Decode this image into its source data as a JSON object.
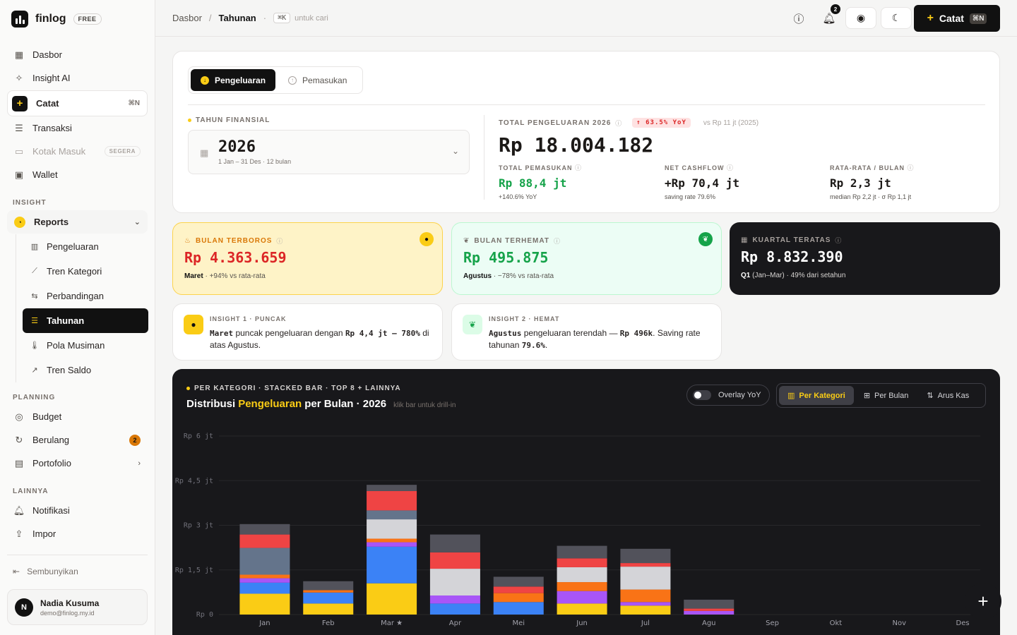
{
  "brand": {
    "name": "finlog",
    "plan": "FREE"
  },
  "sidebar": {
    "main": [
      {
        "label": "Dasbor",
        "icon": "grid-icon"
      },
      {
        "label": "Insight AI",
        "icon": "sparkle-icon"
      }
    ],
    "catat": {
      "label": "Catat",
      "shortcut": "⌘N"
    },
    "records": [
      {
        "label": "Transaksi"
      },
      {
        "label": "Kotak Masuk",
        "tag": "SEGERA"
      },
      {
        "label": "Wallet"
      }
    ],
    "insight_label": "INSIGHT",
    "reports": {
      "label": "Reports"
    },
    "report_items": [
      {
        "label": "Pengeluaran"
      },
      {
        "label": "Tren Kategori"
      },
      {
        "label": "Perbandingan"
      },
      {
        "label": "Tahunan"
      },
      {
        "label": "Pola Musiman"
      },
      {
        "label": "Tren Saldo"
      }
    ],
    "planning_label": "PLANNING",
    "planning": [
      {
        "label": "Budget"
      },
      {
        "label": "Berulang",
        "count": "2"
      },
      {
        "label": "Portofolio"
      }
    ],
    "other_label": "LAINNYA",
    "other": [
      {
        "label": "Notifikasi"
      },
      {
        "label": "Impor"
      }
    ],
    "hide_label": "Sembunyikan",
    "user": {
      "initial": "N",
      "name": "Nadia Kusuma",
      "email": "demo@finlog.my.id"
    }
  },
  "topbar": {
    "crumb_root": "Dasbor",
    "crumb_current": "Tahunan",
    "search_key": "⌘K",
    "search_hint": "untuk cari",
    "notif_count": "2",
    "catat_label": "Catat",
    "catat_shortcut": "⌘N"
  },
  "summary": {
    "tabs": [
      "Pengeluaran",
      "Pemasukan"
    ],
    "fiscal_label": "TAHUN FINANSIAL",
    "year": "2026",
    "year_range": "1 Jan – 31 Des · 12 bulan",
    "total_label": "TOTAL PENGELUARAN 2026",
    "yoy": "↑ 63.5% YoY",
    "vs_prev": "vs Rp 11 jt (2025)",
    "total_value": "Rp 18.004.182",
    "kpis": [
      {
        "label": "TOTAL PEMASUKAN",
        "value": "Rp 88,4 jt",
        "sub": "+140.6% YoY"
      },
      {
        "label": "NET CASHFLOW",
        "value": "+Rp 70,4 jt",
        "sub": "saving rate 79.6%"
      },
      {
        "label": "RATA-RATA / BULAN",
        "value": "Rp 2,3 jt",
        "sub": "median Rp 2,2 jt · σ Rp 1,1 jt"
      }
    ]
  },
  "highlights": {
    "boros": {
      "label": "BULAN TERBOROS",
      "value": "Rp 4.363.659",
      "month": "Maret",
      "note": " · +94% vs rata-rata"
    },
    "hemat": {
      "label": "BULAN TERHEMAT",
      "value": "Rp 495.875",
      "month": "Agustus",
      "note": " · −78% vs rata-rata"
    },
    "kuartal": {
      "label": "KUARTAL TERATAS",
      "value": "Rp 8.832.390",
      "quarter": "Q1",
      "note": " (Jan–Mar) · 49% dari setahun"
    }
  },
  "insights": [
    {
      "label": "INSIGHT 1 · PUNCAK",
      "b1": "Maret",
      "t1": " puncak pengeluaran dengan ",
      "b2": "Rp 4,4 jt — 780%",
      "t2": " di atas Agustus."
    },
    {
      "label": "INSIGHT 2 · HEMAT",
      "b1": "Agustus",
      "t1": " pengeluaran terendah — ",
      "b2": "Rp 496k",
      "t2": ". Saving rate tahunan ",
      "b3": "79.6%",
      "t3": "."
    }
  ],
  "chart_panel": {
    "label": "PER KATEGORI · STACKED BAR · TOP 8 + LAINNYA",
    "title_pre": "Distribusi ",
    "title_hl": "Pengeluaran",
    "title_post": " per Bulan · 2026",
    "hint": "klik bar untuk drill-in",
    "overlay_label": "Overlay YoY",
    "views": [
      "Per Kategori",
      "Per Bulan",
      "Arus Kas"
    ]
  },
  "colors": {
    "accent": "#facc15",
    "yellow": "#facc15",
    "blue": "#3b82f6",
    "purple": "#a855f7",
    "orange": "#f97316",
    "lightgray": "#d4d4d8",
    "slate": "#64748b",
    "red": "#ef4444",
    "gray": "#52525b"
  },
  "chart_data": {
    "type": "bar",
    "stacked": true,
    "categories": [
      "Jan",
      "Feb",
      "Mar ★",
      "Apr",
      "Mei",
      "Jun",
      "Jul",
      "Agu",
      "Sep",
      "Okt",
      "Nov",
      "Des"
    ],
    "y_ticks": [
      "Rp 0",
      "Rp 1,5 jt",
      "Rp 3 jt",
      "Rp 4,5 jt",
      "Rp 6 jt"
    ],
    "ylim": [
      0,
      6000000
    ],
    "series": [
      {
        "color": "#facc15",
        "values": [
          700000,
          370000,
          1050000,
          0,
          0,
          370000,
          300000,
          0,
          0,
          0,
          0,
          0
        ]
      },
      {
        "color": "#3b82f6",
        "values": [
          370000,
          370000,
          1230000,
          370000,
          420000,
          0,
          0,
          0,
          0,
          0,
          0,
          0
        ]
      },
      {
        "color": "#a855f7",
        "values": [
          150000,
          0,
          150000,
          270000,
          0,
          420000,
          120000,
          120000,
          0,
          0,
          0,
          0
        ]
      },
      {
        "color": "#f97316",
        "values": [
          120000,
          80000,
          120000,
          0,
          300000,
          300000,
          420000,
          0,
          0,
          0,
          0,
          0
        ]
      },
      {
        "color": "#d4d4d8",
        "values": [
          0,
          0,
          650000,
          900000,
          0,
          500000,
          770000,
          0,
          0,
          0,
          0,
          0
        ]
      },
      {
        "color": "#64748b",
        "values": [
          900000,
          0,
          300000,
          0,
          0,
          0,
          0,
          0,
          0,
          0,
          0,
          0
        ]
      },
      {
        "color": "#ef4444",
        "values": [
          450000,
          0,
          650000,
          550000,
          220000,
          300000,
          120000,
          80000,
          0,
          0,
          0,
          0
        ]
      },
      {
        "color": "#52525b",
        "values": [
          350000,
          300000,
          210000,
          600000,
          330000,
          420000,
          480000,
          300000,
          0,
          0,
          0,
          0
        ]
      }
    ]
  }
}
